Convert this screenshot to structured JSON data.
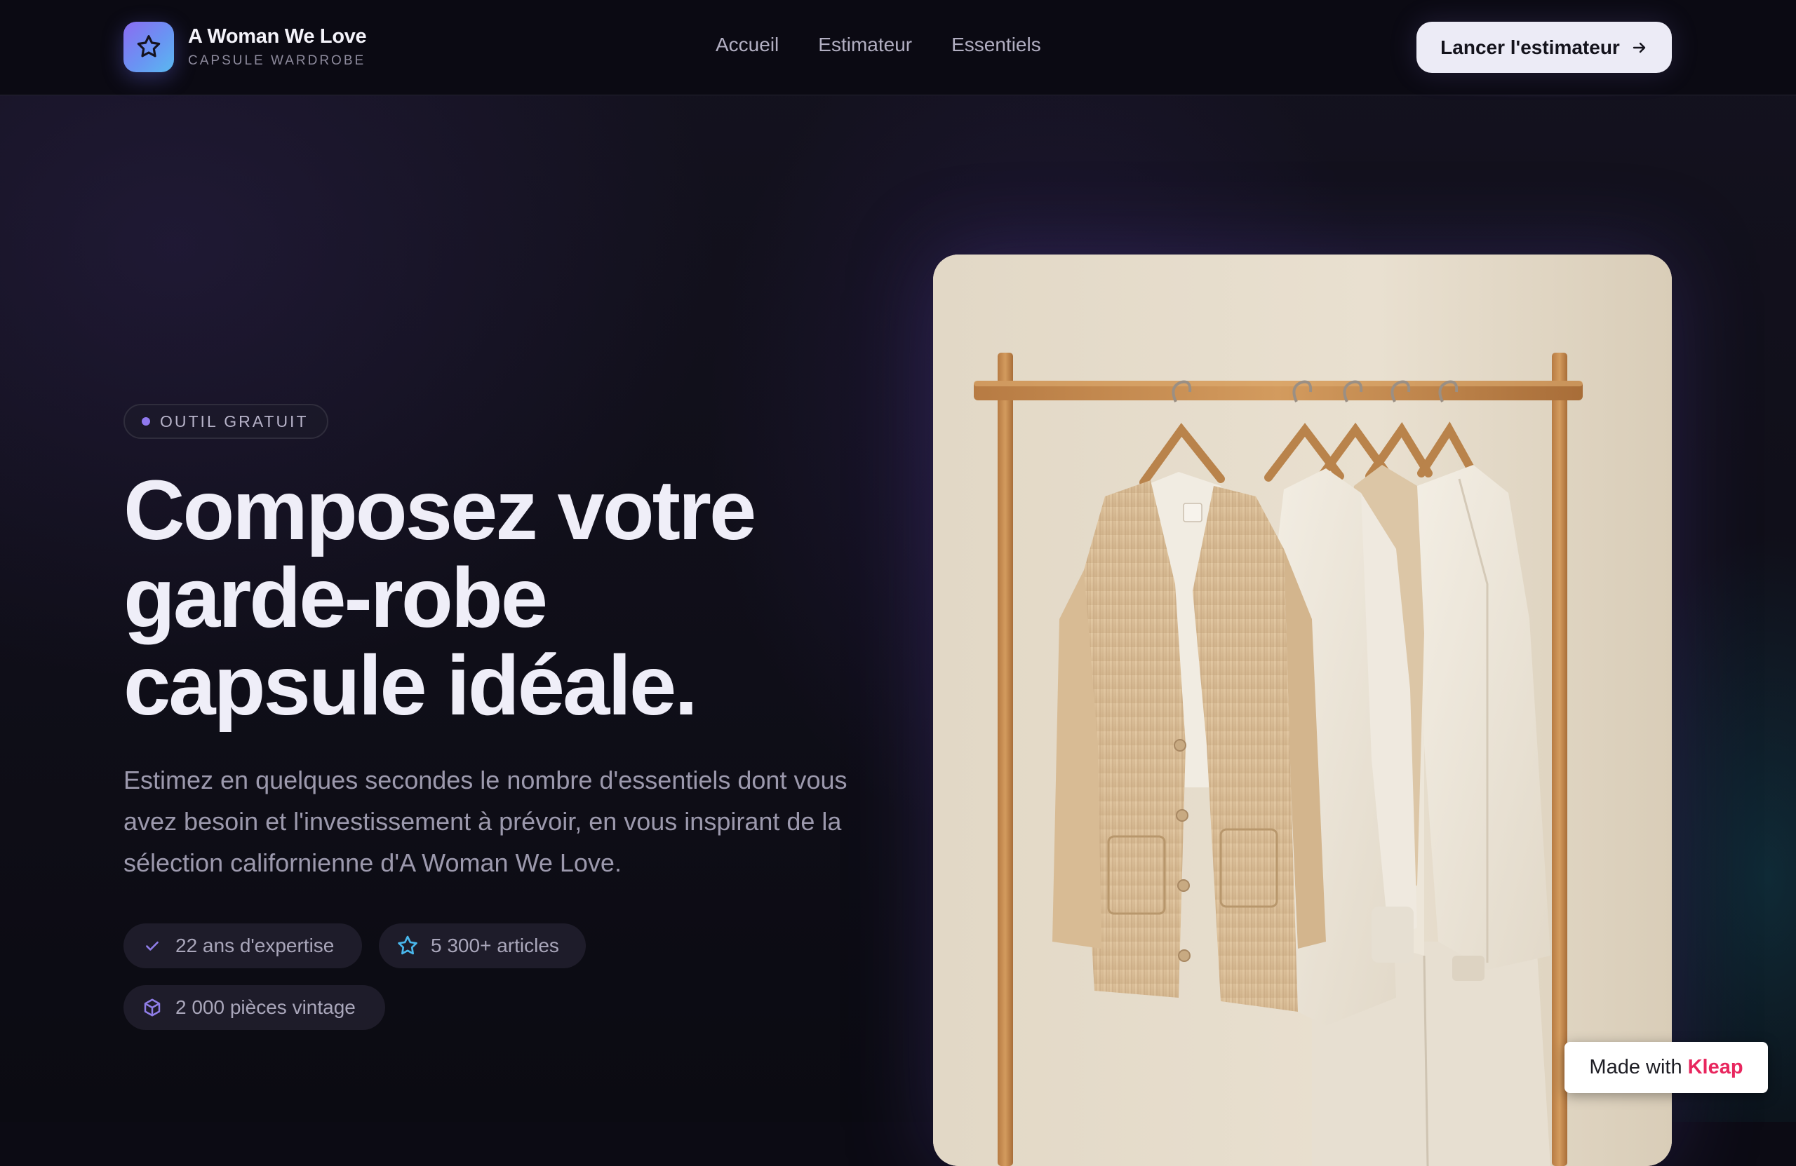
{
  "brand": {
    "name": "A Woman We Love",
    "tagline": "CAPSULE WARDROBE",
    "logo_icon": "star-icon",
    "gradient": [
      "#8b6cf2",
      "#5ab9f0"
    ]
  },
  "nav": {
    "items": [
      {
        "label": "Accueil"
      },
      {
        "label": "Estimateur"
      },
      {
        "label": "Essentiels"
      }
    ]
  },
  "cta": {
    "label": "Lancer l'estimateur",
    "icon": "arrow-right-icon"
  },
  "hero": {
    "pill": "OUTIL GRATUIT",
    "headline": [
      "Composez votre",
      "garde-robe",
      "capsule idéale."
    ],
    "lead": "Estimez en quelques secondes le nombre d'essentiels dont vous avez besoin et l'investissement à prévoir, en vous inspirant de la sélection californienne d'A Woman We Love.",
    "stats": [
      {
        "label": "22 ans d'expertise",
        "icon": "check-icon",
        "color": "#8f7de8"
      },
      {
        "label": "5 300+ articles",
        "icon": "star-icon",
        "color": "#49b7ec"
      },
      {
        "label": "2 000 pièces vintage",
        "icon": "box-icon",
        "color": "#8f7de8"
      }
    ]
  },
  "image": {
    "subject": "clothing-rack-illustration"
  },
  "badge": {
    "prefix": "Made with",
    "brand": "Kleap",
    "brand_color": "#e8265e"
  }
}
